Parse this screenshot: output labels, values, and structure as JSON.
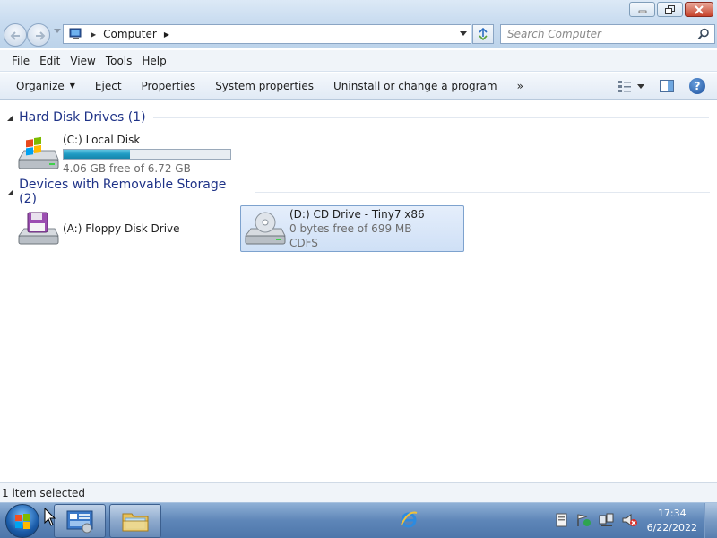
{
  "window": {
    "minimize_label": "",
    "maximize_label": "",
    "close_label": ""
  },
  "address": {
    "location": "Computer"
  },
  "search": {
    "placeholder": "Search Computer"
  },
  "menu": {
    "items": [
      "File",
      "Edit",
      "View",
      "Tools",
      "Help"
    ]
  },
  "commands": {
    "organize": "Organize",
    "eject": "Eject",
    "properties": "Properties",
    "system_properties": "System properties",
    "uninstall": "Uninstall or change a program",
    "more": "»"
  },
  "groups": {
    "hard_disks": {
      "title": "Hard Disk Drives (1)",
      "items": [
        {
          "name": "(C:) Local Disk",
          "free": "4.06 GB free of 6.72 GB",
          "used_fraction": 0.4
        }
      ]
    },
    "removable": {
      "title": "Devices with Removable Storage (2)",
      "items": [
        {
          "name": "(A:) Floppy Disk Drive"
        },
        {
          "name": "(D:) CD Drive - Tiny7 x86",
          "free": "0 bytes free of 699 MB",
          "fs": "CDFS"
        }
      ]
    }
  },
  "status": {
    "text": "1 item selected"
  },
  "taskbar": {
    "time": "17:34",
    "date": "6/22/2022"
  },
  "colors": {
    "group_title": "#1e3287",
    "selection_border": "#7da2ce",
    "capacity_fill": "#1e9ac3"
  }
}
